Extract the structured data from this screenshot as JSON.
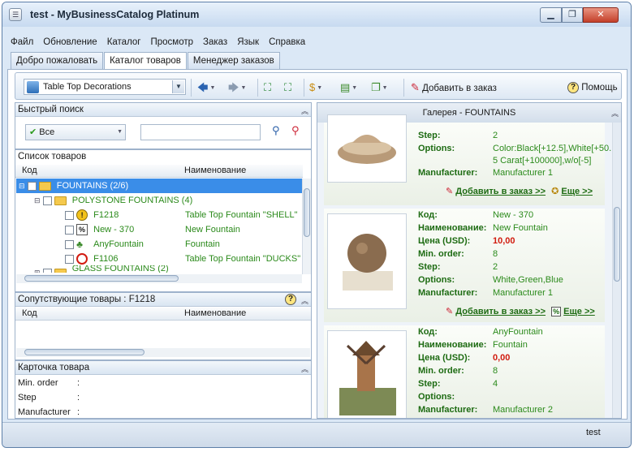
{
  "window": {
    "title": "test - MyBusinessCatalog Platinum",
    "min": "▁",
    "max": "❐",
    "close": "✕"
  },
  "menu": [
    "Файл",
    "Обновление",
    "Каталог",
    "Просмотр",
    "Заказ",
    "Язык",
    "Справка"
  ],
  "tabs": [
    "Добро пожаловать",
    "Каталог товаров",
    "Менеджер заказов"
  ],
  "toolbar": {
    "catalog": "Table Top Decorations",
    "add_to_order": "Добавить в заказ",
    "help": "Помощь"
  },
  "quick_search": {
    "title": "Быстрый поиск",
    "filter": "Все",
    "query": ""
  },
  "product_list": {
    "title": "Список товаров",
    "col_code": "Код",
    "col_name": "Наименование",
    "rows": [
      {
        "code": "FOUNTAINS   (2/6)",
        "name": ""
      },
      {
        "code": "POLYSTONE FOUNTAINS   (4)",
        "name": ""
      },
      {
        "code": "F1218",
        "name": "Table Top Fountain \"SHELL\""
      },
      {
        "code": "New - 370",
        "name": "New Fountain"
      },
      {
        "code": "AnyFountain",
        "name": "Fountain"
      },
      {
        "code": "F1106",
        "name": "Table Top Fountain \"DUCKS\""
      },
      {
        "code": "GLASS FOUNTAINS   (2)",
        "name": ""
      }
    ]
  },
  "related": {
    "title": "Сопутствующие товары : F1218",
    "col_code": "Код",
    "col_name": "Наименование"
  },
  "card": {
    "title": "Карточка товара",
    "fields": [
      {
        "label": "Min. order",
        "value": ":"
      },
      {
        "label": "Step",
        "value": ":"
      },
      {
        "label": "Manufacturer",
        "value": ":"
      }
    ]
  },
  "gallery": {
    "title": "Галерея - FOUNTAINS",
    "labels": {
      "code": "Код:",
      "name": "Наименование:",
      "price": "Цена (USD):",
      "min": "Min. order:",
      "step": "Step:",
      "options": "Options:",
      "manufacturer": "Manufacturer:"
    },
    "add_link": "Добавить в заказ >>",
    "more_link": "Еще >>",
    "item1": {
      "step": "2",
      "options1": "Color:Black[+12.5],White[+50.",
      "options2": "5 Carat[+100000],w/o[-5]",
      "manufacturer": "Manufacturer 1"
    },
    "item2": {
      "code": "New - 370",
      "name": "New Fountain",
      "price": "10,00",
      "min": "8",
      "step": "2",
      "options": "White,Green,Blue",
      "manufacturer": "Manufacturer 1"
    },
    "item3": {
      "code": "AnyFountain",
      "name": "Fountain",
      "price": "0,00",
      "min": "8",
      "step": "4",
      "options": "",
      "manufacturer": "Manufacturer 2"
    }
  },
  "status": {
    "user": "test"
  }
}
